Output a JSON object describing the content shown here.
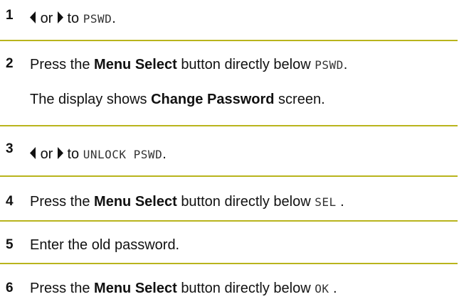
{
  "colors": {
    "divider": "#b9b41c",
    "text": "#111111"
  },
  "steps": [
    {
      "number": "1",
      "or_text": "or",
      "to_text": "to",
      "lcd": "PSWD",
      "end": "."
    },
    {
      "number": "2",
      "line1_pre": "Press the",
      "bold1": "Menu Select",
      "line1_post": "button directly below",
      "lcd": "PSWD",
      "end": ".",
      "line2_pre": "The display shows",
      "bold2": "Change Password",
      "line2_post": "screen."
    },
    {
      "number": "3",
      "or_text": "or",
      "to_text": "to",
      "lcd": "UNLOCK PSWD",
      "end": "."
    },
    {
      "number": "4",
      "pre": "Press the",
      "bold": "Menu Select",
      "post": "button directly below",
      "lcd": "SEL",
      "end": " ."
    },
    {
      "number": "5",
      "text": "Enter the old password."
    },
    {
      "number": "6",
      "pre": "Press the",
      "bold": "Menu Select",
      "post": "button directly below",
      "lcd": "OK",
      "end": " ."
    }
  ],
  "icons": {
    "left": "left-arrow-icon",
    "right": "right-arrow-icon"
  }
}
